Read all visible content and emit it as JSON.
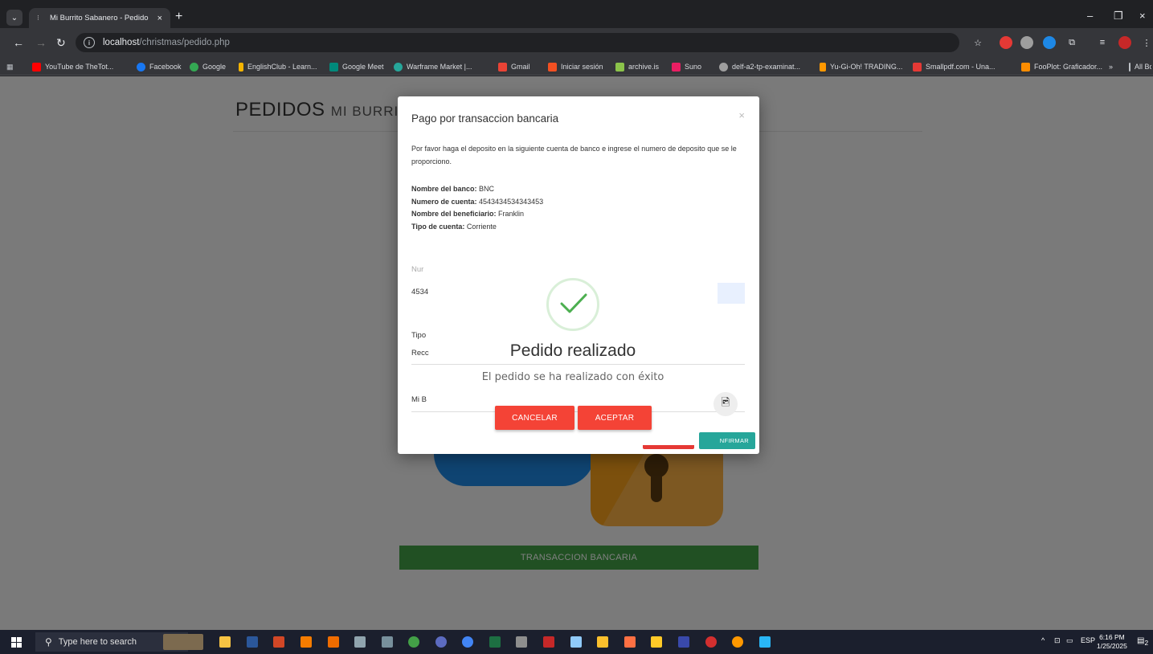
{
  "browser": {
    "tab_title": "Mi Burrito Sabanero - Pedido",
    "tab_close": "×",
    "new_tab": "+",
    "url_host": "localhost",
    "url_path": "/christmas/pedido.php",
    "window_minimize": "–",
    "window_restore": "❐",
    "window_close": "×",
    "bookmarks": [
      {
        "label": "YouTube de TheTot...",
        "color": "#ff0000"
      },
      {
        "label": "Facebook",
        "color": "#1877f2"
      },
      {
        "label": "Google",
        "color": "#34a853"
      },
      {
        "label": "EnglishClub - Learn...",
        "color": "#f4b400"
      },
      {
        "label": "Google Meet",
        "color": "#00897b"
      },
      {
        "label": "Warframe Market |...",
        "color": "#26a69a"
      },
      {
        "label": "Gmail",
        "color": "#ea4335"
      },
      {
        "label": "Iniciar sesión",
        "color": "#f25022"
      },
      {
        "label": "archive.is",
        "color": "#8bc34a"
      },
      {
        "label": "Suno",
        "color": "#e91e63"
      },
      {
        "label": "delf-a2-tp-examinat...",
        "color": "#9e9e9e"
      },
      {
        "label": "Yu-Gi-Oh! TRADING...",
        "color": "#ff9800"
      },
      {
        "label": "Smallpdf.com - Una...",
        "color": "#e53935"
      },
      {
        "label": "FooPlot: Graficador...",
        "color": "#fb8c00"
      }
    ],
    "bookmarks_more": "»",
    "all_bookmarks": "All Bookmarks"
  },
  "page": {
    "title": "PEDIDOS",
    "title_sub": "MI BURRITO SABANERO",
    "transfer_button": "TRANSACCION BANCARIA"
  },
  "modal": {
    "title": "Pago por transaccion bancaria",
    "close": "×",
    "instructions": "Por favor haga el deposito en la siguiente cuenta de banco e ingrese el numero de deposito que se le proporciono.",
    "bank_name_label": "Nombre del banco:",
    "bank_name": "BNC",
    "account_number_label": "Numero de cuenta:",
    "account_number": "4543434534343453",
    "beneficiary_label": "Nombre del beneficiario:",
    "beneficiary": "Franklin",
    "account_type_label": "Tipo de cuenta:",
    "account_type": "Corriente",
    "field1_label": "Nur",
    "field1_value": "4534",
    "field2_label": "Tipo",
    "field2_value": "Recc",
    "field3_value": "Mi B",
    "confirm_button": "NFIRMAR"
  },
  "alert": {
    "title": "Pedido realizado",
    "message": "El pedido se ha realizado con éxito",
    "cancel": "CANCELAR",
    "accept": "ACEPTAR"
  },
  "taskbar": {
    "search_placeholder": "Type here to search",
    "language": "ESP",
    "time": "6:16 PM",
    "date": "1/25/2025",
    "notification_count": "2"
  }
}
